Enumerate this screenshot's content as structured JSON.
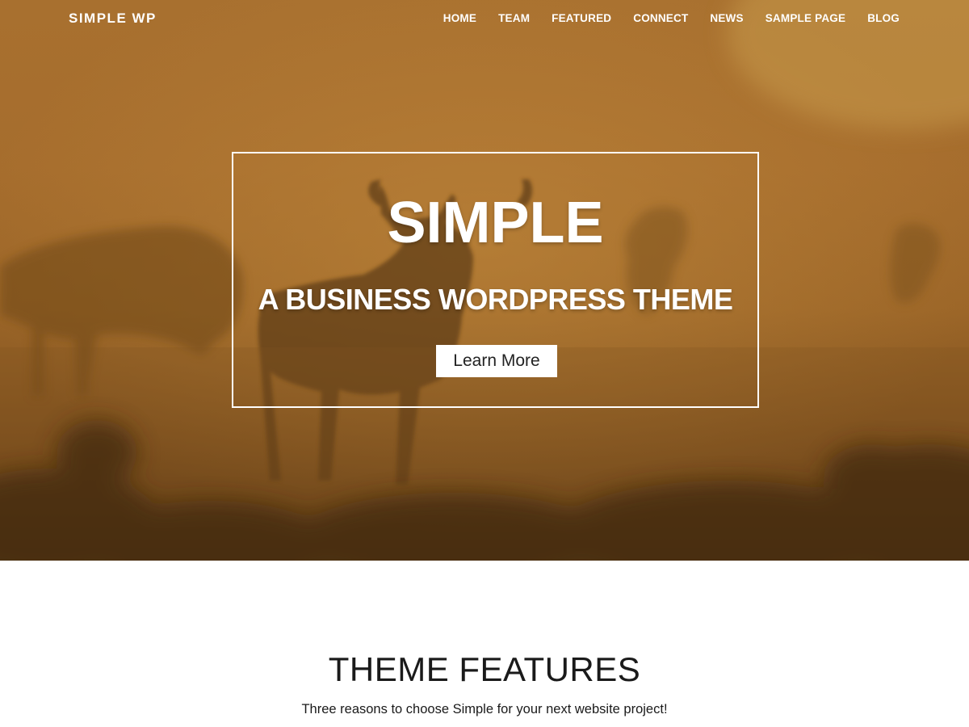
{
  "header": {
    "site_title": "SIMPLE WP",
    "nav": [
      "HOME",
      "TEAM",
      "FEATURED",
      "CONNECT",
      "NEWS",
      "SAMPLE PAGE",
      "BLOG"
    ]
  },
  "hero": {
    "title": "SIMPLE",
    "subtitle": "A BUSINESS WORDPRESS THEME",
    "button_label": "Learn More"
  },
  "features": {
    "title": "THEME FEATURES",
    "subtitle": "Three reasons to choose Simple for your next website project!"
  },
  "colors": {
    "hero_tint": "#a66d2d",
    "text_dark": "#1a1a1a",
    "white": "#ffffff"
  }
}
